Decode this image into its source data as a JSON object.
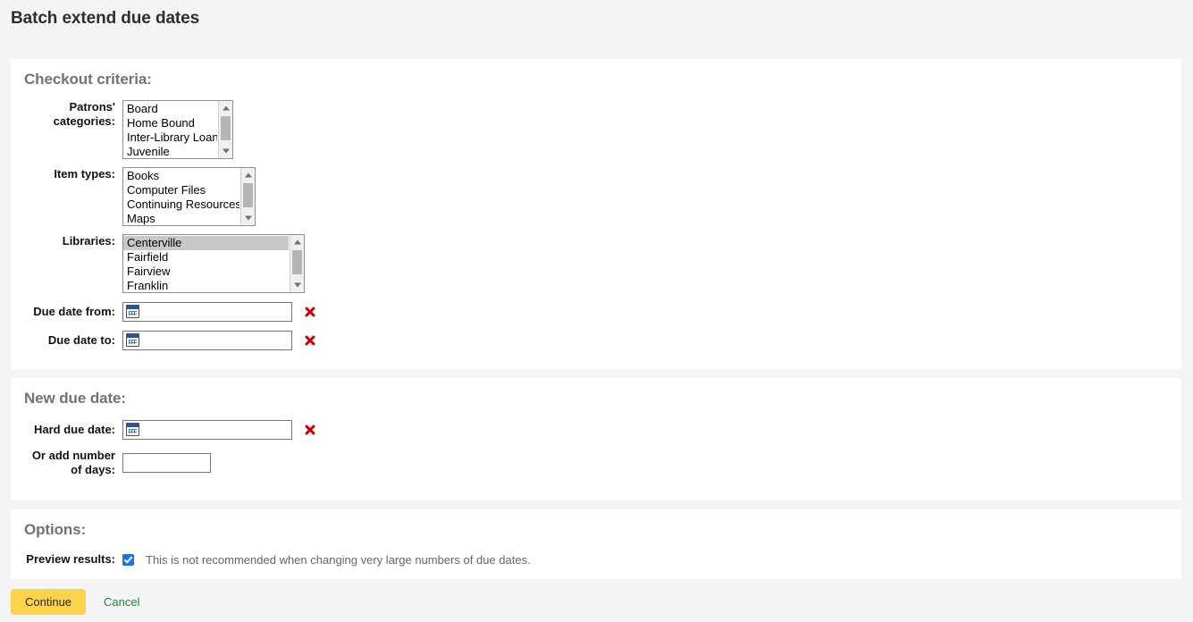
{
  "page": {
    "title": "Batch extend due dates"
  },
  "sections": {
    "criteria": {
      "legend": "Checkout criteria:",
      "patron_categories": {
        "label_line1": "Patrons'",
        "label_line2": "categories:",
        "options": [
          "Board",
          "Home Bound",
          "Inter-Library Loan",
          "Juvenile"
        ],
        "selected": []
      },
      "item_types": {
        "label": "Item types:",
        "options": [
          "Books",
          "Computer Files",
          "Continuing Resources",
          "Maps"
        ],
        "selected": []
      },
      "libraries": {
        "label": "Libraries:",
        "options": [
          "Centerville",
          "Fairfield",
          "Fairview",
          "Franklin"
        ],
        "selected": [
          "Centerville"
        ]
      },
      "due_date_from": {
        "label": "Due date from:",
        "value": "",
        "placeholder": "",
        "icon": "calendar-icon",
        "clear_icon": "clear-x-icon"
      },
      "due_date_to": {
        "label": "Due date to:",
        "value": "",
        "placeholder": "",
        "icon": "calendar-icon",
        "clear_icon": "clear-x-icon"
      }
    },
    "new_due_date": {
      "legend": "New due date:",
      "hard_due_date": {
        "label": "Hard due date:",
        "value": "",
        "placeholder": "",
        "icon": "calendar-icon",
        "clear_icon": "clear-x-icon"
      },
      "add_days": {
        "label_line1": "Or add number",
        "label_line2": "of days:",
        "value": "",
        "placeholder": ""
      }
    },
    "options": {
      "legend": "Options:",
      "preview_results": {
        "label": "Preview results:",
        "checked": true,
        "hint": "This is not recommended when changing very large numbers of due dates."
      }
    }
  },
  "actions": {
    "continue_label": "Continue",
    "cancel_label": "Cancel"
  },
  "colors": {
    "page_background": "#f3f4f4",
    "panel_background": "#ffffff",
    "legend_text": "#727272",
    "primary_button": "#fcd34b",
    "cancel_link": "#218838",
    "clear_icon": "#cc0000",
    "checkbox_checked": "#1a73e8",
    "selected_option": "#c8c8c8"
  }
}
